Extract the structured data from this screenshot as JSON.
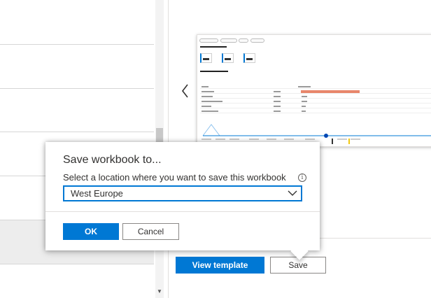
{
  "dialog": {
    "title": "Save workbook to...",
    "label": "Select a location where you want to save this workbook",
    "info_icon": "info-icon",
    "location": "West Europe",
    "ok_label": "OK",
    "cancel_label": "Cancel"
  },
  "actions": {
    "view_template_label": "View template",
    "save_label": "Save"
  },
  "icons": {
    "prev": "chevron-left-icon",
    "dropdown": "chevron-down-icon",
    "scroll_down": "scroll-down-arrow-icon"
  },
  "colors": {
    "accent": "#0078d4",
    "bar": "#e8866b"
  }
}
